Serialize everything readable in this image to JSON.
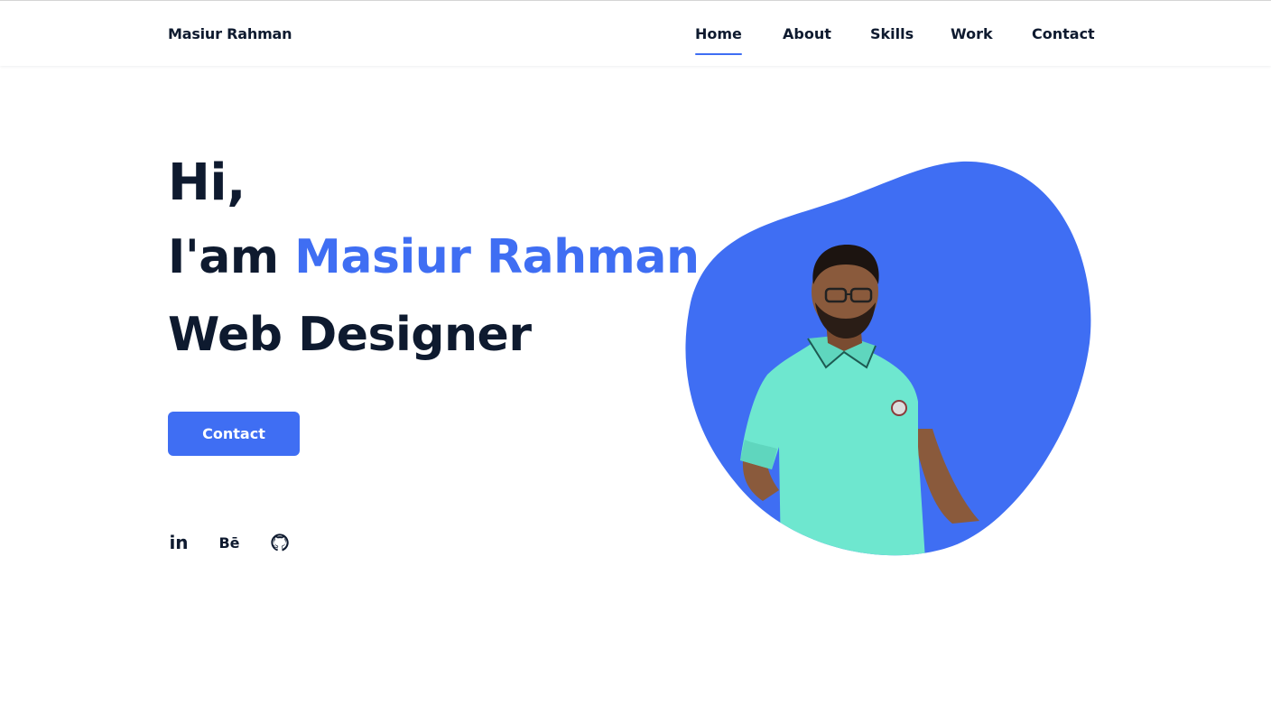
{
  "brand": "Masiur Rahman",
  "nav": {
    "items": [
      {
        "label": "Home",
        "active": true
      },
      {
        "label": "About"
      },
      {
        "label": "Skills"
      },
      {
        "label": "Work"
      },
      {
        "label": "Contact"
      }
    ]
  },
  "hero": {
    "greeting": "Hi,",
    "intro": "I'am ",
    "name": "Masiur Rahman",
    "role": "Web Designer",
    "cta_label": "Contact"
  },
  "social": {
    "linkedin_label": "in",
    "behance_label": "Bē",
    "github_icon": "github-icon"
  },
  "colors": {
    "accent": "#3f6ef3",
    "text": "#0e1a2f",
    "shirt": "#6ee7cf",
    "skin": "#8a5a3c"
  }
}
